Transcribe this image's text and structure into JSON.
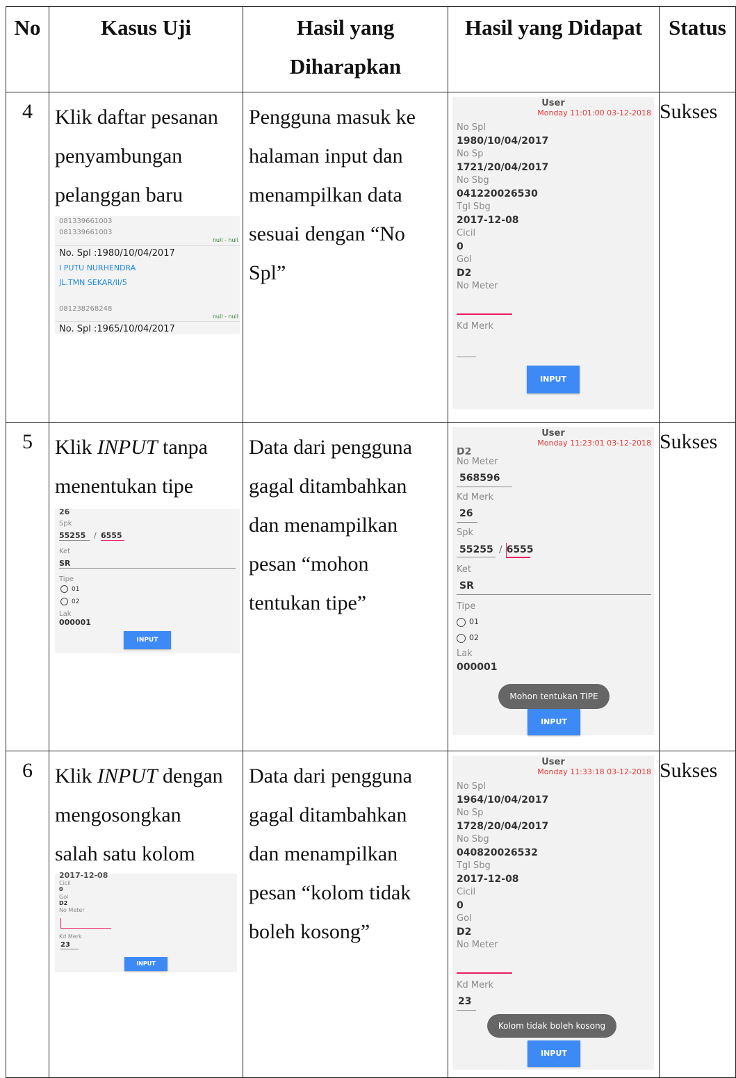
{
  "headers": {
    "no": "No",
    "kasus": "Kasus Uji",
    "hasil_1": "Hasil yang",
    "hasil_2": "Diharapkan",
    "dapat": "Hasil yang Didapat",
    "status": "Status"
  },
  "rows": [
    {
      "no": "4",
      "kasus_lines": [
        "Klik daftar pesanan",
        "penyambungan",
        "pelanggan baru"
      ],
      "hasil_lines": [
        "Pengguna masuk ke",
        "halaman input dan",
        "menampilkan data",
        "sesuai dengan “No",
        "Spl”"
      ],
      "status": "Sukses",
      "mini": {
        "phone_1": "081339661003",
        "phone_2": "081339661003",
        "nullnull_a": "null - null",
        "spl_1": "No. Spl :1980/10/04/2017",
        "name": "I PUTU NURHENDRA",
        "address": "JL.TMN SEKAR/II/5",
        "phone_3": "081238268248",
        "nullnull_b": "null - null",
        "spl_2": "No. Spl :1965/10/04/2017"
      },
      "shot": {
        "user": "User",
        "time": "Monday 11:01:00 03-12-2018",
        "fields": [
          {
            "label": "No Spl",
            "value": "1980/10/04/2017"
          },
          {
            "label": "No Sp",
            "value": "1721/20/04/2017"
          },
          {
            "label": "No Sbg",
            "value": "041220026530"
          },
          {
            "label": "Tgl Sbg",
            "value": "2017-12-08"
          },
          {
            "label": "Cicil",
            "value": "0"
          },
          {
            "label": "Gol",
            "value": "D2"
          }
        ],
        "no_meter": "No Meter",
        "kd_merk": "Kd Merk",
        "button": "INPUT"
      }
    },
    {
      "no": "5",
      "kasus_a": "Klik ",
      "kasus_em": "INPUT",
      "kasus_b": " tanpa",
      "kasus_line2": "menentukan tipe",
      "hasil_lines": [
        "Data dari pengguna",
        "gagal ditambahkan",
        "dan menampilkan",
        "pesan “mohon",
        "tentukan tipe”"
      ],
      "status": "Sukses",
      "mini": {
        "top": "26",
        "spk": "Spk",
        "spk_a": "55255",
        "spk_b": "6555",
        "ket": "Ket",
        "ket_val": "SR",
        "tipe": "Tipe",
        "opt1": "01",
        "opt2": "02",
        "lak": "Lak",
        "lak_val": "000001",
        "button": "INPUT"
      },
      "shot": {
        "user": "User",
        "time": "Monday 11:23:01 03-12-2018",
        "top": "D2",
        "no_meter": "No Meter",
        "no_meter_val": "568596",
        "kd_merk": "Kd Merk",
        "kd_merk_val": "26",
        "spk": "Spk",
        "spk_a": "55255",
        "spk_b": "6555",
        "ket": "Ket",
        "ket_val": "SR",
        "tipe": "Tipe",
        "opt1": "01",
        "opt2": "02",
        "lak": "Lak",
        "lak_val": "000001",
        "toast": "Mohon tentukan TIPE",
        "button": "INPUT"
      }
    },
    {
      "no": "6",
      "kasus_a": "Klik ",
      "kasus_em": "INPUT",
      "kasus_b": " dengan",
      "kasus_line2": "mengosongkan",
      "kasus_line3": "salah satu kolom",
      "hasil_lines": [
        "Data dari pengguna",
        "gagal ditambahkan",
        "dan menampilkan",
        "pesan “kolom tidak",
        "boleh kosong”"
      ],
      "status": "Sukses",
      "mini": {
        "tgl": "2017-12-08",
        "cicil": "Cicil",
        "cicil_val": "0",
        "gol": "Gol",
        "gol_val": "D2",
        "no_meter": "No Meter",
        "kd_merk": "Kd Merk",
        "kd_merk_val": "23",
        "button": "INPUT"
      },
      "shot": {
        "user": "User",
        "time": "Monday 11:33:18 03-12-2018",
        "fields": [
          {
            "label": "No Spl",
            "value": "1964/10/04/2017"
          },
          {
            "label": "No Sp",
            "value": "1728/20/04/2017"
          },
          {
            "label": "No Sbg",
            "value": "040820026532"
          },
          {
            "label": "Tgl Sbg",
            "value": "2017-12-08"
          },
          {
            "label": "Cicil",
            "value": "0"
          },
          {
            "label": "Gol",
            "value": "D2"
          }
        ],
        "no_meter": "No Meter",
        "kd_merk": "Kd Merk",
        "kd_merk_val": "23",
        "toast": "Kolom tidak boleh kosong",
        "button": "INPUT"
      }
    }
  ]
}
